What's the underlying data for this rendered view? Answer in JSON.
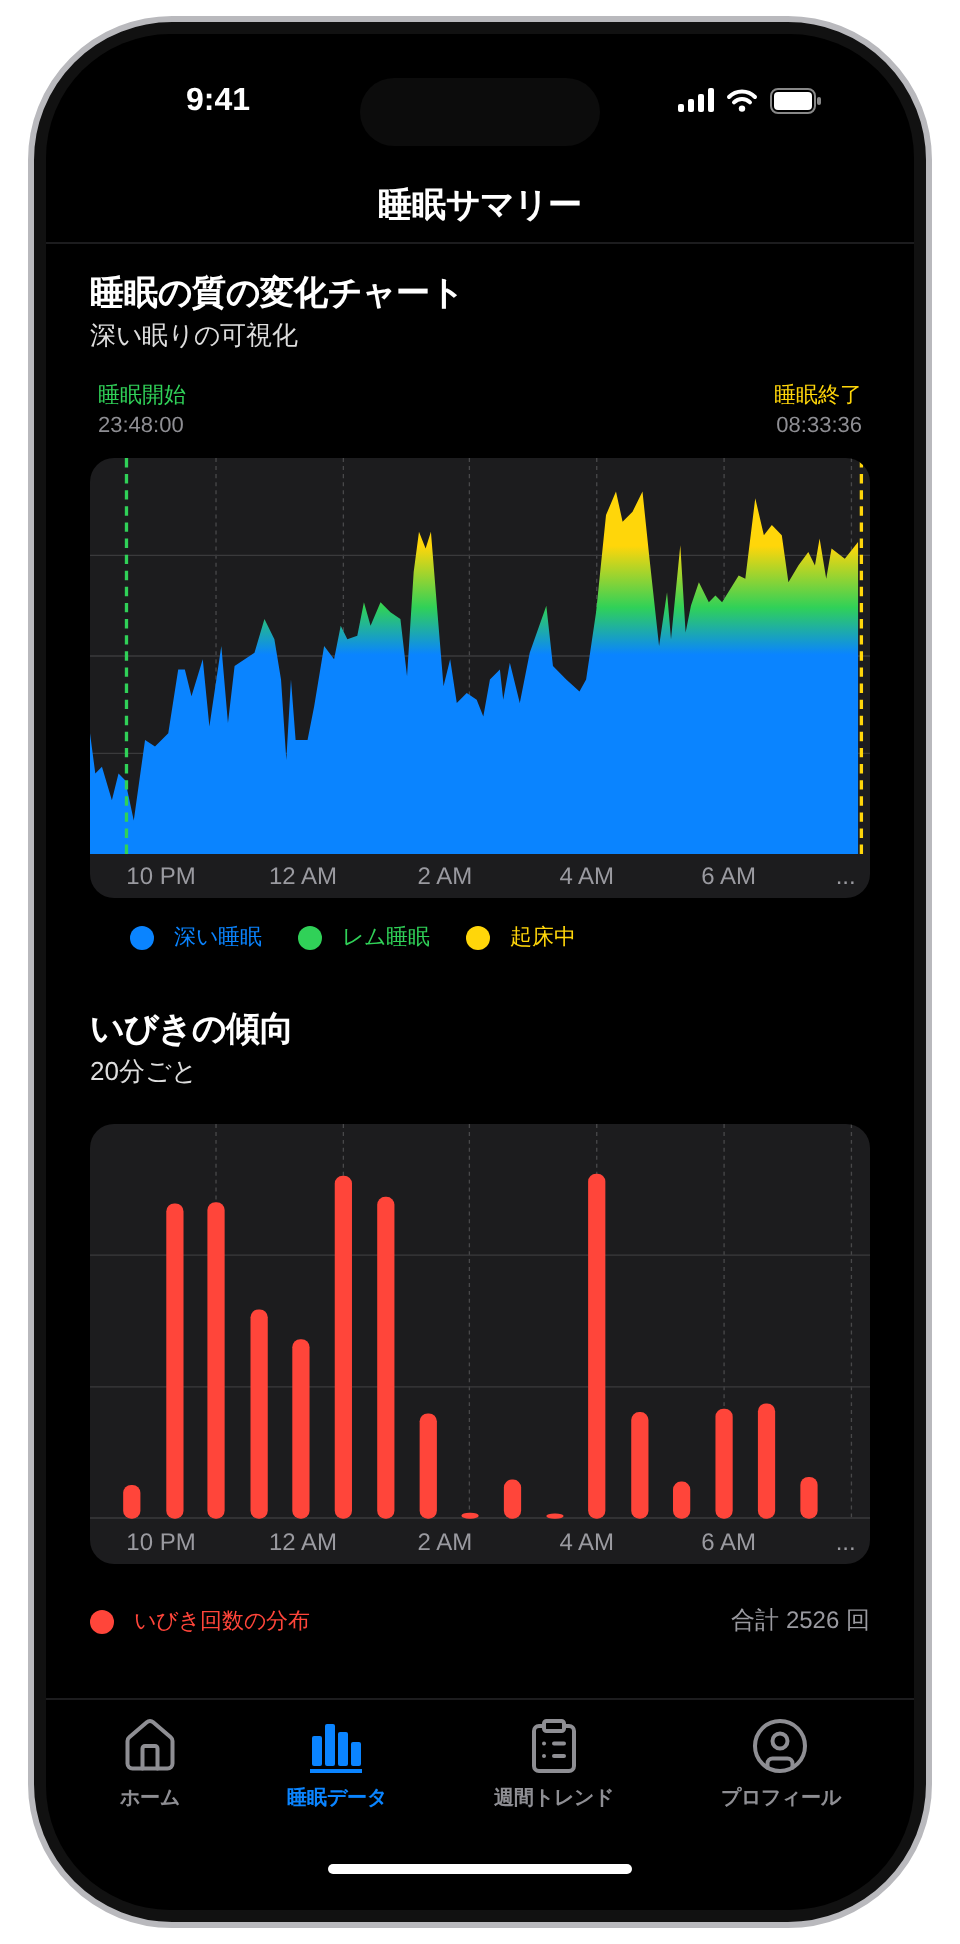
{
  "status_bar": {
    "time": "9:41"
  },
  "nav": {
    "title": "睡眠サマリー"
  },
  "quality_section": {
    "title": "睡眠の質の変化チャート",
    "subtitle": "深い眠りの可視化",
    "start": {
      "label": "睡眠開始",
      "time": "23:48:00"
    },
    "end": {
      "label": "睡眠終了",
      "time": "08:33:36"
    },
    "x_labels": [
      "10 PM",
      "12 AM",
      "2 AM",
      "4 AM",
      "6 AM",
      "..."
    ],
    "legend": [
      {
        "label": "深い睡眠",
        "color": "#0a84ff"
      },
      {
        "label": "レム睡眠",
        "color": "#30d158"
      },
      {
        "label": "起床中",
        "color": "#ffd60a"
      }
    ]
  },
  "snoring_section": {
    "title": "いびきの傾向",
    "subtitle": "20分ごと",
    "x_labels": [
      "10 PM",
      "12 AM",
      "2 AM",
      "4 AM",
      "6 AM",
      "..."
    ],
    "legend": {
      "label": "いびき回数の分布",
      "color": "#ff453a"
    },
    "total": "合計 2526 回"
  },
  "tabs": [
    {
      "label": "ホーム",
      "kind": "home",
      "selected": false
    },
    {
      "label": "睡眠データ",
      "kind": "bars",
      "selected": true
    },
    {
      "label": "週間トレンド",
      "kind": "clipboard",
      "selected": false
    },
    {
      "label": "プロフィール",
      "kind": "profile",
      "selected": false
    }
  ]
}
